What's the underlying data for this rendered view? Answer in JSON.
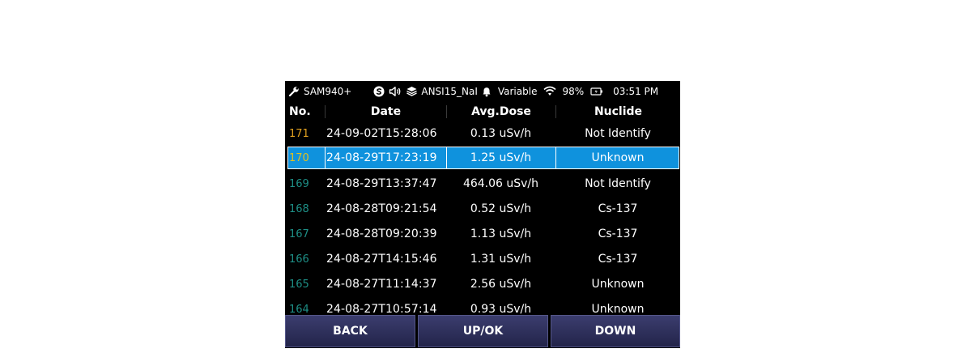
{
  "status_bar": {
    "device_name": "SAM940+",
    "library": "ANSI15_NaI",
    "mode": "Variable",
    "battery": "98%",
    "time": "03:51 PM"
  },
  "table": {
    "headers": {
      "no": "No.",
      "date": "Date",
      "dose": "Avg.Dose",
      "nuclide": "Nuclide"
    },
    "rows": [
      {
        "no": "171",
        "date": "24-09-02T15:28:06",
        "dose": "0.13 uSv/h",
        "nuclide": "Not Identify",
        "no_color": "#e0a020"
      },
      {
        "no": "170",
        "date": "24-08-29T17:23:19",
        "dose": "1.25 uSv/h",
        "nuclide": "Unknown",
        "no_color": "#e0c020"
      },
      {
        "no": "169",
        "date": "24-08-29T13:37:47",
        "dose": "464.06 uSv/h",
        "nuclide": "Not Identify",
        "no_color": "#1e8f86"
      },
      {
        "no": "168",
        "date": "24-08-28T09:21:54",
        "dose": "0.52 uSv/h",
        "nuclide": "Cs-137",
        "no_color": "#1e8f86"
      },
      {
        "no": "167",
        "date": "24-08-28T09:20:39",
        "dose": "1.13 uSv/h",
        "nuclide": "Cs-137",
        "no_color": "#1e8f86"
      },
      {
        "no": "166",
        "date": "24-08-27T14:15:46",
        "dose": "1.31 uSv/h",
        "nuclide": "Cs-137",
        "no_color": "#1e8f86"
      },
      {
        "no": "165",
        "date": "24-08-27T11:14:37",
        "dose": "2.56 uSv/h",
        "nuclide": "Unknown",
        "no_color": "#1e8f86"
      },
      {
        "no": "164",
        "date": "24-08-27T10:57:14",
        "dose": "0.93 uSv/h",
        "nuclide": "Unknown",
        "no_color": "#1e8f86"
      }
    ],
    "selected_index": 1
  },
  "buttons": {
    "back": "BACK",
    "upok": "UP/OK",
    "down": "DOWN"
  },
  "colors": {
    "screen_bg": "#000000",
    "selection": "#0f92dd",
    "button": "#2f3160"
  },
  "icons": [
    "wrench-icon",
    "s-badge-icon",
    "speaker-icon",
    "shield-icon",
    "bell-icon",
    "wifi-icon",
    "battery-icon"
  ]
}
